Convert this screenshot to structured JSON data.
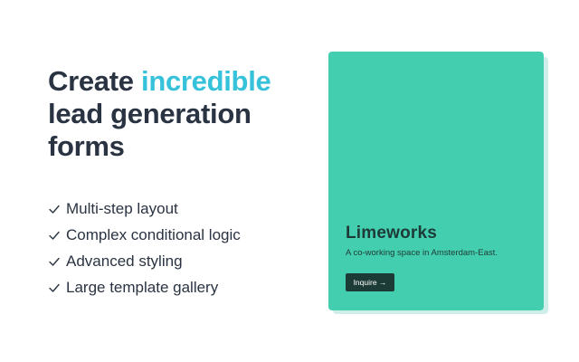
{
  "hero": {
    "title_part1": "Create ",
    "title_accent": "incredible",
    "title_part2": " lead generation forms",
    "accent_color": "#35c2da"
  },
  "features": [
    {
      "label": "Multi-step layout",
      "icon": "check-icon"
    },
    {
      "label": "Complex conditional logic",
      "icon": "check-icon"
    },
    {
      "label": "Advanced styling",
      "icon": "check-icon"
    },
    {
      "label": "Large template gallery",
      "icon": "check-icon"
    }
  ],
  "card": {
    "title": "Limeworks",
    "subtitle": "A co-working space in Amsterdam-East.",
    "button_label": "Inquire →",
    "background_color": "#43ceaf",
    "button_color": "#1d3b36"
  }
}
